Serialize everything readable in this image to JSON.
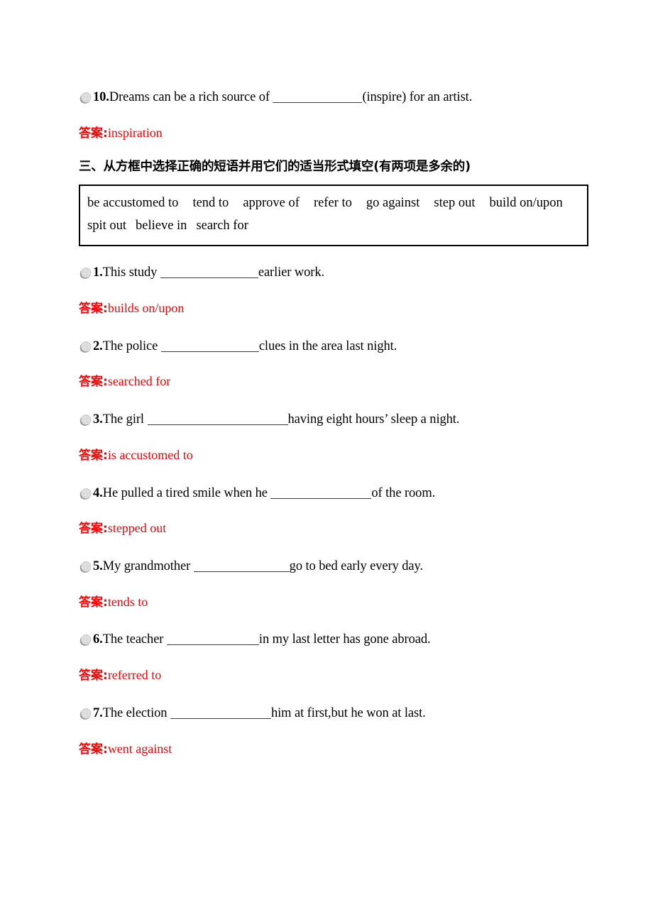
{
  "answer_label": "答案",
  "colors": {
    "answer_red": "#ff0000",
    "text_black": "#000000",
    "blank_rule": "#3a3a3a",
    "box_border": "#000000",
    "bullet_light": "#d9d9d9",
    "bullet_dark": "#9a9a9a"
  },
  "top_item": {
    "number": "10.",
    "text_before": "Dreams can be a rich source of ",
    "blank_width": 126,
    "text_after": "(inspire) for an artist.",
    "answer": "inspiration"
  },
  "section": {
    "heading": "三、从方框中选择正确的短语并用它们的适当形式填空(有两项是多余的)"
  },
  "word_bank": {
    "line1": [
      "be accustomed to",
      "tend to",
      "approve of",
      "refer to",
      "go against",
      "step out",
      "build on/upon"
    ],
    "line2": [
      "spit out",
      "believe in",
      "search for"
    ]
  },
  "items": [
    {
      "number": "1.",
      "text_before": "This study ",
      "blank_width": 138,
      "text_after": "earlier work.",
      "answer": "builds on/upon"
    },
    {
      "number": "2.",
      "text_before": "The police ",
      "blank_width": 138,
      "text_after": "clues in the area last night.",
      "answer": "searched for"
    },
    {
      "number": "3.",
      "text_before": "The girl ",
      "blank_width": 198,
      "text_after": "having eight hours’  sleep a night.",
      "answer": "is accustomed to"
    },
    {
      "number": "4.",
      "text_before": "He pulled a tired smile when he ",
      "blank_width": 142,
      "text_after": "of the room.",
      "answer": "stepped out"
    },
    {
      "number": "5.",
      "text_before": "My grandmother ",
      "blank_width": 135,
      "text_after": "go to bed early every day.",
      "answer": "tends to"
    },
    {
      "number": "6.",
      "text_before": "The teacher ",
      "blank_width": 130,
      "text_after": "in my last letter has gone abroad.",
      "answer": "referred to"
    },
    {
      "number": "7.",
      "text_before": "The election ",
      "blank_width": 142,
      "text_after": "him at first,but he won at last.",
      "answer": "went against"
    }
  ]
}
